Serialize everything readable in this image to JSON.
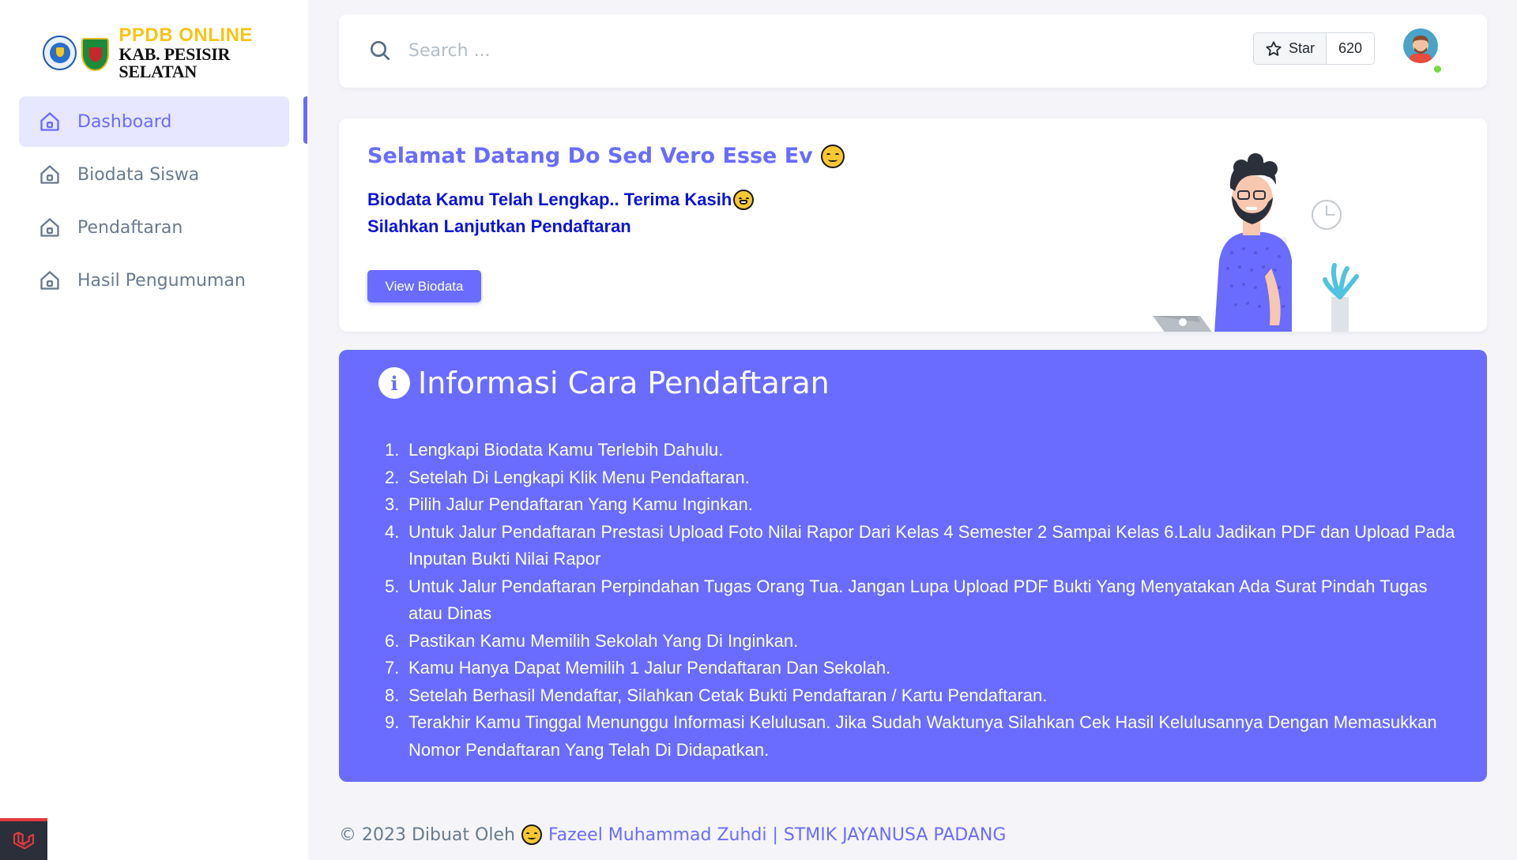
{
  "brand": {
    "title": "PPDB ONLINE",
    "subtitle": "KAB. PESISIR SELATAN"
  },
  "sidebar": {
    "items": [
      {
        "label": "Dashboard",
        "icon": "home-icon",
        "active": true
      },
      {
        "label": "Biodata Siswa",
        "icon": "home-icon",
        "active": false
      },
      {
        "label": "Pendaftaran",
        "icon": "home-icon",
        "active": false
      },
      {
        "label": "Hasil Pengumuman",
        "icon": "home-icon",
        "active": false
      }
    ]
  },
  "navbar": {
    "search_placeholder": "Search ...",
    "star_label": "Star",
    "star_count": "620"
  },
  "welcome": {
    "title": "Selamat Datang Do Sed Vero Esse Ev",
    "message_line1": "Biodata Kamu Telah Lengkap.. Terima Kasih",
    "message_line2": "Silahkan Lanjutkan Pendaftaran",
    "button_label": "View Biodata"
  },
  "info": {
    "title": "Informasi Cara Pendaftaran",
    "steps": [
      {
        "num": "1.",
        "text": "Lengkapi Biodata Kamu Terlebih Dahulu."
      },
      {
        "num": "2.",
        "text": "Setelah Di Lengkapi Klik Menu Pendaftaran."
      },
      {
        "num": "3.",
        "text": "Pilih Jalur Pendaftaran Yang Kamu Inginkan."
      },
      {
        "num": "4.",
        "text": "Untuk Jalur Pendaftaran Prestasi Upload Foto Nilai Rapor Dari Kelas 4 Semester 2 Sampai Kelas 6.Lalu Jadikan PDF dan Upload Pada Inputan Bukti Nilai Rapor"
      },
      {
        "num": "5.",
        "text": "Untuk Jalur Pendaftaran Perpindahan Tugas Orang Tua. Jangan Lupa Upload PDF Bukti Yang Menyatakan Ada Surat Pindah Tugas atau Dinas"
      },
      {
        "num": "6.",
        "text": "Pastikan Kamu Memilih Sekolah Yang Di Inginkan."
      },
      {
        "num": "7.",
        "text": "Kamu Hanya Dapat Memilih 1 Jalur Pendaftaran Dan Sekolah."
      },
      {
        "num": "8.",
        "text": "Setelah Berhasil Mendaftar, Silahkan Cetak Bukti Pendaftaran / Kartu Pendaftaran."
      },
      {
        "num": "9.",
        "text": "Terakhir Kamu Tinggal Menunggu Informasi Kelulusan. Jika Sudah Waktunya Silahkan Cek Hasil Kelulusannya Dengan Memasukkan Nomor Pendaftaran Yang Telah Di Didapatkan."
      }
    ]
  },
  "footer": {
    "prefix": "© 2023 Dibuat Oleh",
    "link_text": "Fazeel Muhammad Zuhdi | STMIK JAYANUSA PADANG"
  },
  "colors": {
    "primary": "#696cff",
    "menu_active_bg": "#e7e7ff",
    "welcome_message": "#0a14d6",
    "brand_yellow": "#f6c417",
    "online": "#71dd37"
  }
}
